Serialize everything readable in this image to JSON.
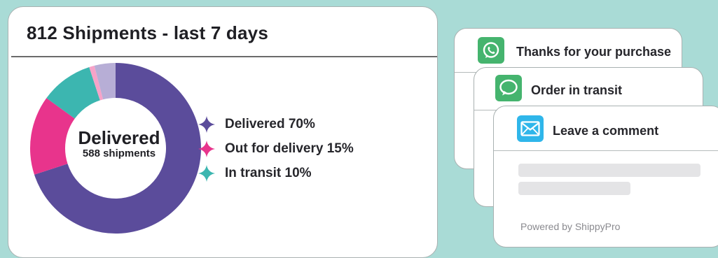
{
  "summary": {
    "title": "812 Shipments - last 7 days",
    "center_label": "Delivered",
    "center_sublabel": "588 shipments"
  },
  "chart_data": {
    "type": "pie",
    "categories": [
      "Delivered",
      "Out for delivery",
      "In transit",
      "Other (pink)",
      "Other (lavender)"
    ],
    "values": [
      70,
      15,
      10,
      1,
      4
    ],
    "colors": [
      "#5b4c9b",
      "#e8348c",
      "#3cb6b0",
      "#f6a3c8",
      "#b7aed6"
    ],
    "legend": [
      "Delivered 70%",
      "Out for delivery 15%",
      "In transit 10%"
    ],
    "legend_colors": [
      "#5b4c9b",
      "#e8348c",
      "#3cb6b0"
    ],
    "legend_position": "right"
  },
  "notifications": [
    {
      "text": "Thanks for your purchase",
      "icon": "whatsapp-icon",
      "icon_color": "#45b46e"
    },
    {
      "text": "Order in transit",
      "icon": "chat-bubble-icon",
      "icon_color": "#45b46e"
    },
    {
      "text": "Leave a comment",
      "icon": "envelope-icon",
      "icon_color": "#2fb6ea"
    }
  ],
  "footer": {
    "powered_by": "Powered by ShippyPro"
  }
}
